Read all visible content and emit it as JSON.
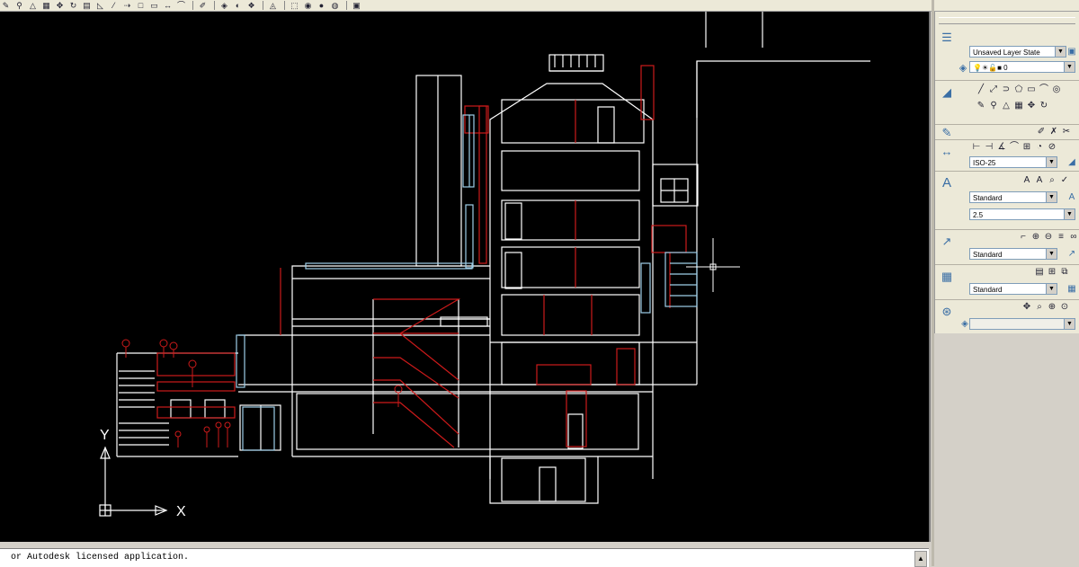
{
  "toolbar": {
    "icons": [
      "pencil-icon",
      "match-properties-icon",
      "triangle-icon",
      "grid-icon",
      "pan-icon",
      "orbit-icon",
      "document-icon",
      "ruler-icon",
      "line-icon",
      "arrow-line-icon",
      "rectangle-icon",
      "square-icon",
      "move-icon",
      "curve-icon",
      "brush-icon",
      "paint-icon",
      "render-icon",
      "light-icon",
      "walk-icon",
      "fly-icon",
      "view-icon",
      "cube-icon",
      "shade-icon",
      "material-icon",
      "lamp-icon"
    ]
  },
  "command_line": {
    "text": "or Autodesk licensed application."
  },
  "palette": {
    "layer_state": "Unsaved Layer State",
    "layer_current": "0",
    "dim_style": "ISO-25",
    "text_style": "Standard",
    "text_height": "2.5",
    "mleader_style": "Standard",
    "table_style": "Standard"
  },
  "ucs": {
    "x_label": "X",
    "y_label": "Y"
  },
  "colors": {
    "viewport_bg": "#000000",
    "line_white": "#ffffff",
    "line_red": "#cc1a1a",
    "line_cyan": "#9ecfe8"
  }
}
